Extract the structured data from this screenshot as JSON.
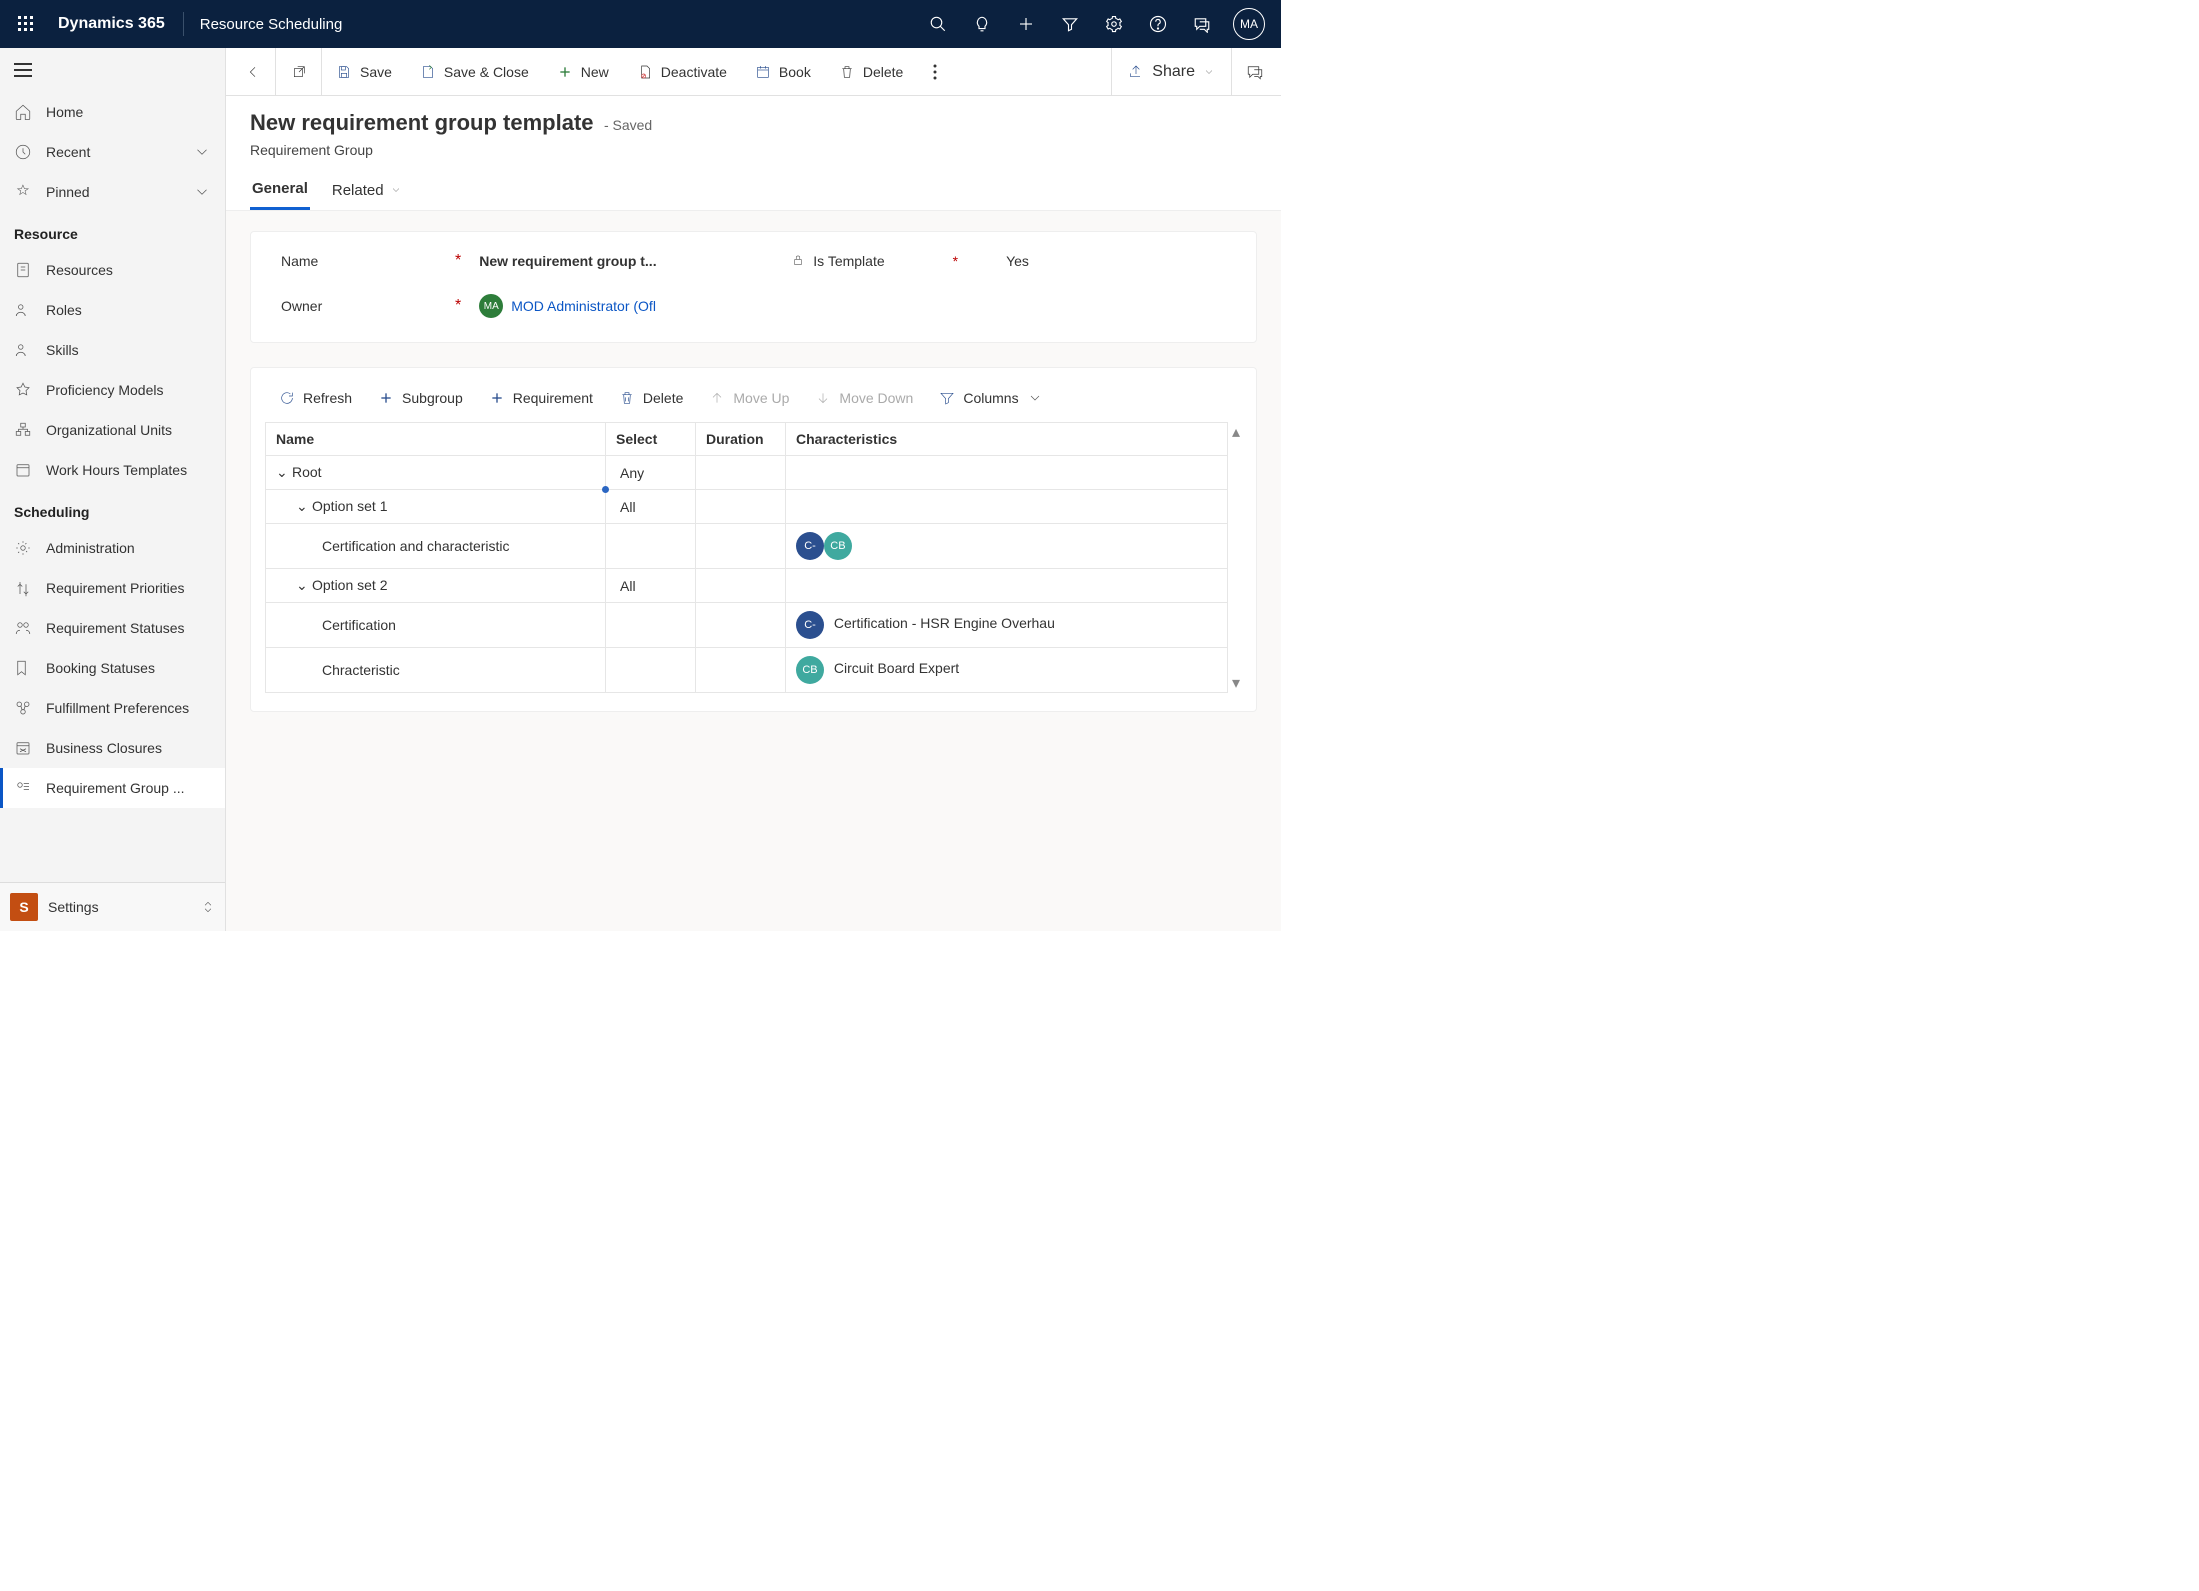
{
  "header": {
    "brand": "Dynamics 365",
    "module": "Resource Scheduling",
    "avatar": "MA"
  },
  "leftnav": {
    "home": "Home",
    "recent": "Recent",
    "pinned": "Pinned",
    "sections": {
      "resource": {
        "title": "Resource",
        "items": [
          "Resources",
          "Roles",
          "Skills",
          "Proficiency Models",
          "Organizational Units",
          "Work Hours Templates"
        ]
      },
      "scheduling": {
        "title": "Scheduling",
        "items": [
          "Administration",
          "Requirement Priorities",
          "Requirement Statuses",
          "Booking Statuses",
          "Fulfillment Preferences",
          "Business Closures",
          "Requirement Group ..."
        ]
      }
    },
    "appLabel": "Settings",
    "appInitial": "S"
  },
  "commandbar": {
    "save": "Save",
    "saveclose": "Save & Close",
    "new": "New",
    "deactivate": "Deactivate",
    "book": "Book",
    "delete": "Delete",
    "share": "Share"
  },
  "page": {
    "title": "New requirement group template",
    "saved": "- Saved",
    "entity": "Requirement Group",
    "tabs": {
      "general": "General",
      "related": "Related"
    }
  },
  "form": {
    "labels": {
      "name": "Name",
      "owner": "Owner",
      "istemplate": "Is Template"
    },
    "values": {
      "name": "New requirement group t...",
      "owner": "MOD Administrator (Ofl",
      "ownerInitials": "MA",
      "istemplate": "Yes"
    }
  },
  "grid": {
    "toolbar": {
      "refresh": "Refresh",
      "subgroup": "Subgroup",
      "requirement": "Requirement",
      "delete": "Delete",
      "moveup": "Move Up",
      "movedown": "Move Down",
      "columns": "Columns"
    },
    "columns": {
      "name": "Name",
      "select": "Select",
      "duration": "Duration",
      "characteristics": "Characteristics"
    },
    "rows": {
      "root": {
        "name": "Root",
        "select": "Any"
      },
      "opt1": {
        "name": "Option set 1",
        "select": "All"
      },
      "cert_char": {
        "name": "Certification and characteristic",
        "b1": "C-",
        "b2": "CB"
      },
      "opt2": {
        "name": "Option set 2",
        "select": "All"
      },
      "cert": {
        "name": "Certification",
        "b1": "C-",
        "text": "Certification - HSR Engine Overhau"
      },
      "charac": {
        "name": "Chracteristic",
        "b1": "CB",
        "text": "Circuit Board Expert"
      }
    }
  }
}
